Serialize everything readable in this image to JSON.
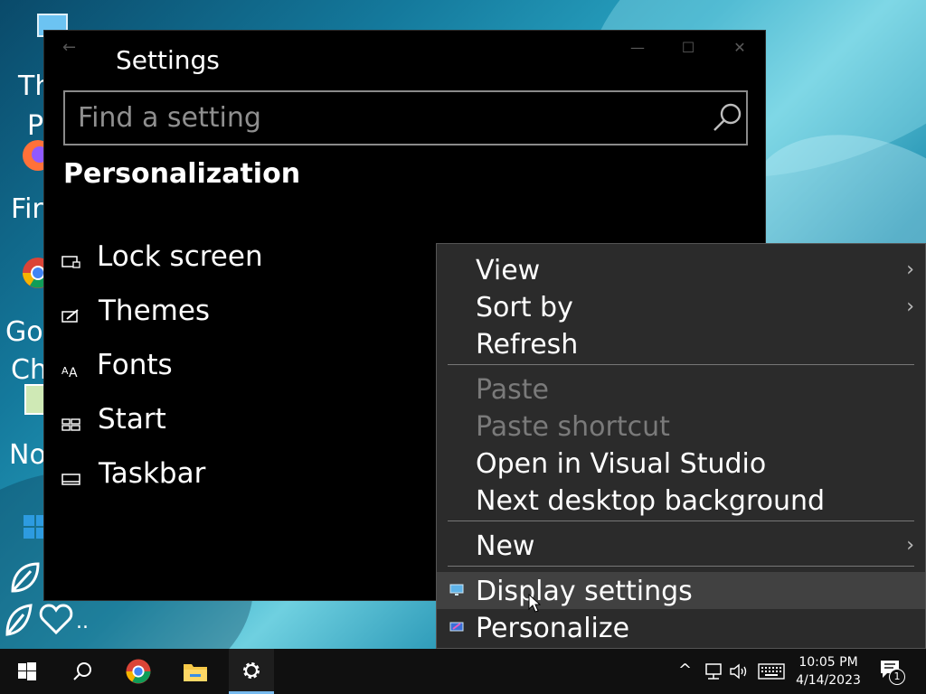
{
  "desktop": {
    "icon_labels": [
      "Th",
      "P",
      "Fir",
      "Go",
      "Ch",
      "No",
      ".."
    ]
  },
  "settings_window": {
    "title": "Settings",
    "back_glyph": "←",
    "minimize_glyph": "—",
    "maximize_glyph": "☐",
    "close_glyph": "✕",
    "search": {
      "placeholder": "Find a setting",
      "value": ""
    },
    "section_title": "Personalization",
    "nav_items": [
      {
        "label": "Lock screen",
        "icon": "lock-screen-icon"
      },
      {
        "label": "Themes",
        "icon": "themes-icon"
      },
      {
        "label": "Fonts",
        "icon": "fonts-icon"
      },
      {
        "label": "Start",
        "icon": "start-icon"
      },
      {
        "label": "Taskbar",
        "icon": "taskbar-icon"
      }
    ]
  },
  "context_menu": {
    "items": [
      {
        "label": "View",
        "submenu": true,
        "disabled": false
      },
      {
        "label": "Sort by",
        "submenu": true,
        "disabled": false
      },
      {
        "label": "Refresh",
        "submenu": false,
        "disabled": false
      },
      {
        "label": "Paste",
        "submenu": false,
        "disabled": true
      },
      {
        "label": "Paste shortcut",
        "submenu": false,
        "disabled": true
      },
      {
        "label": "Open in Visual Studio",
        "submenu": false,
        "disabled": false
      },
      {
        "label": "Next desktop background",
        "submenu": false,
        "disabled": false
      },
      {
        "label": "New",
        "submenu": true,
        "disabled": false
      },
      {
        "label": "Display settings",
        "submenu": false,
        "disabled": false,
        "icon": "display-icon"
      },
      {
        "label": "Personalize",
        "submenu": false,
        "disabled": false,
        "icon": "personalize-icon"
      }
    ],
    "submenu_arrow": "›"
  },
  "taskbar": {
    "clock_time": "10:05 PM",
    "clock_date": "4/14/2023",
    "notification_count": "1",
    "tray_chevron": "^"
  },
  "colors": {
    "accent": "#76b9ed",
    "menu_bg": "#2b2b2b",
    "window_bg": "#000000",
    "taskbar_bg": "#101010"
  }
}
